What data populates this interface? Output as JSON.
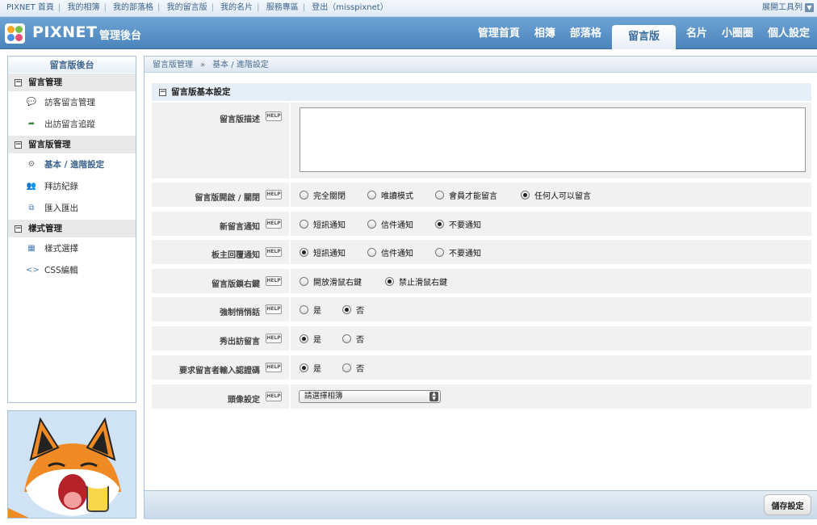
{
  "topbar": {
    "links": [
      "PIXNET 首頁",
      "我的相簿",
      "我的部落格",
      "我的留言版",
      "我的名片",
      "服務專區",
      "登出（misspixnet）"
    ],
    "toolbar_toggle": "展開工具列"
  },
  "header": {
    "brand": "PIXNET",
    "subtitle": "管理後台",
    "nav": [
      "管理首頁",
      "相簿",
      "部落格",
      "留言版",
      "名片",
      "小圈圈",
      "個人設定"
    ],
    "active_nav": "留言版"
  },
  "sidebar": {
    "title": "留言版後台",
    "sections": [
      {
        "label": "留言管理",
        "items": [
          "訪客留言管理",
          "出訪留言追蹤"
        ]
      },
      {
        "label": "留言版管理",
        "items": [
          "基本 / 進階設定",
          "拜訪紀錄",
          "匯入匯出"
        ]
      },
      {
        "label": "樣式管理",
        "items": [
          "樣式選擇",
          "CSS編輯"
        ]
      }
    ],
    "active_item": "基本 / 進階設定"
  },
  "breadcrumb": {
    "root": "留言版管理",
    "separator": "»",
    "current": "基本 / 進階設定"
  },
  "panel": {
    "title": "留言版基本設定"
  },
  "help_label": "HELP",
  "settings": {
    "description": {
      "label": "留言版描述",
      "value": ""
    },
    "open_close": {
      "label": "留言版開啟 / 關閉",
      "options": [
        "完全關閉",
        "唯讀模式",
        "會員才能留言",
        "任何人可以留言"
      ],
      "selected": 3
    },
    "new_notify": {
      "label": "新留言通知",
      "options": [
        "短訊通知",
        "信件通知",
        "不要通知"
      ],
      "selected": 2
    },
    "reply_notify": {
      "label": "板主回覆通知",
      "options": [
        "短訊通知",
        "信件通知",
        "不要通知"
      ],
      "selected": 0
    },
    "right_click": {
      "label": "留言版鎖右鍵",
      "options": [
        "開放滑鼠右鍵",
        "禁止滑鼠右鍵"
      ],
      "selected": 1
    },
    "force_private": {
      "label": "強制悄悄話",
      "options": [
        "是",
        "否"
      ],
      "selected": 1
    },
    "show_visits": {
      "label": "秀出訪留言",
      "options": [
        "是",
        "否"
      ],
      "selected": 0
    },
    "captcha": {
      "label": "要求留言者輸入認證碼",
      "options": [
        "是",
        "否"
      ],
      "selected": 0
    },
    "avatar": {
      "label": "頭像設定",
      "select_value": "請選擇相簿"
    }
  },
  "save_label": "儲存設定",
  "colors": {
    "header_blue": "#5a93c9",
    "link_blue": "#3c648c",
    "row_bg": "#f1f1f1"
  }
}
